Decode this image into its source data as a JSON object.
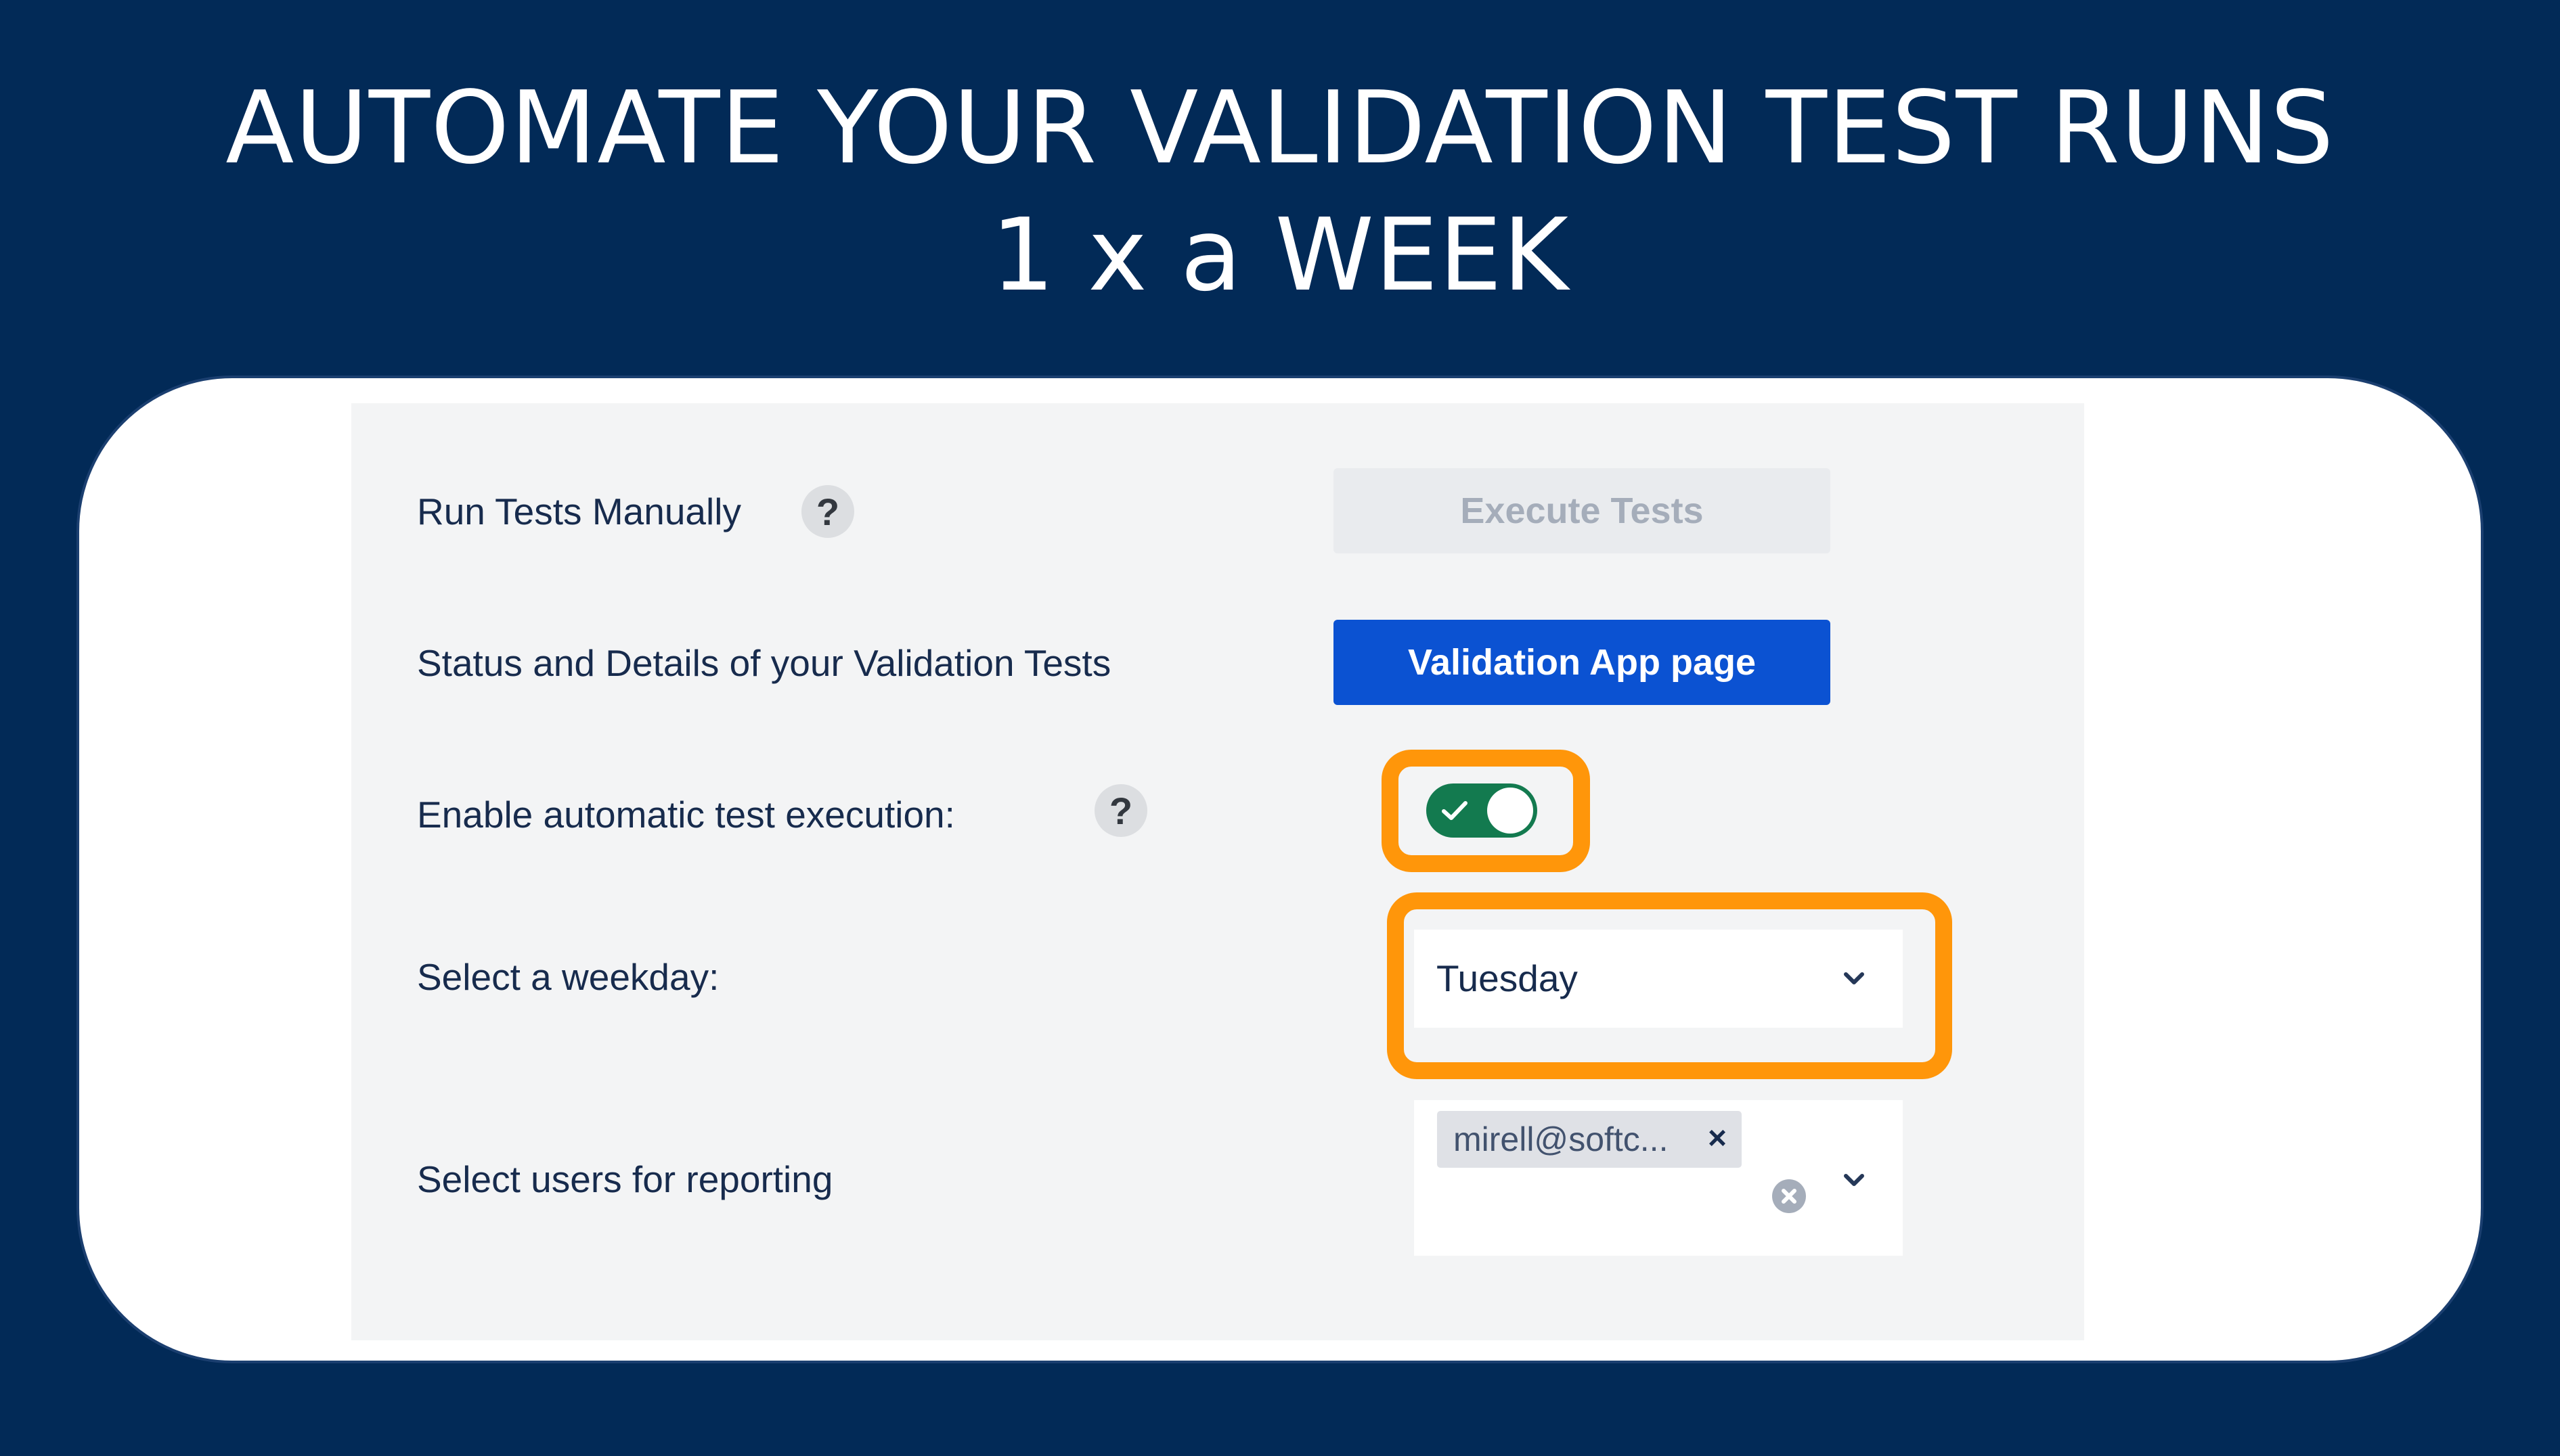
{
  "headline": {
    "line1": "AUTOMATE YOUR VALIDATION TEST RUNS",
    "line2": "1 x a WEEK"
  },
  "settings": {
    "run_manually": {
      "label": "Run Tests Manually",
      "help": "?",
      "button_label": "Execute Tests",
      "button_disabled": true
    },
    "status": {
      "label": "Status and Details of your Validation Tests",
      "button_label": "Validation App page"
    },
    "auto_execution": {
      "label": "Enable automatic test execution:",
      "help": "?",
      "enabled": true,
      "toggle_icon": "check-icon"
    },
    "weekday": {
      "label": "Select a weekday:",
      "value": "Tuesday",
      "icon": "chevron-down-icon"
    },
    "reporting": {
      "label": "Select users for reporting",
      "selected_users": [
        "mirell@softc..."
      ],
      "remove_glyph": "×",
      "icons": [
        "clear-icon",
        "chevron-down-icon"
      ]
    }
  },
  "colors": {
    "background": "#022a57",
    "primary_button": "#0b52d2",
    "toggle_on": "#137a4f",
    "highlight": "#ff960a"
  }
}
